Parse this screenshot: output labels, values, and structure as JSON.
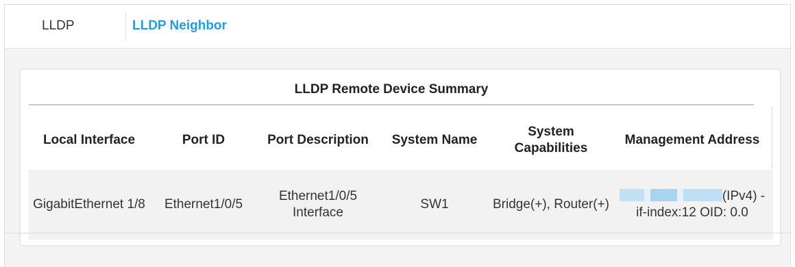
{
  "tabs": [
    {
      "label": "LLDP",
      "active": false
    },
    {
      "label": "LLDP Neighbor",
      "active": true
    }
  ],
  "accent_color": "#1f9ee8",
  "summary": {
    "title": "LLDP Remote Device Summary",
    "columns": [
      "Local Interface",
      "Port ID",
      "Port Description",
      "System Name",
      "System Capabilities",
      "Management Address"
    ],
    "rows": [
      {
        "local_interface": "GigabitEthernet 1/8",
        "port_id": "Ethernet1/0/5",
        "port_description": "Ethernet1/0/5 Interface",
        "system_name": "SW1",
        "system_capabilities": "Bridge(+), Router(+)",
        "management_address_suffix": "(IPv4) - if-index:12 OID: 0.0"
      }
    ]
  }
}
